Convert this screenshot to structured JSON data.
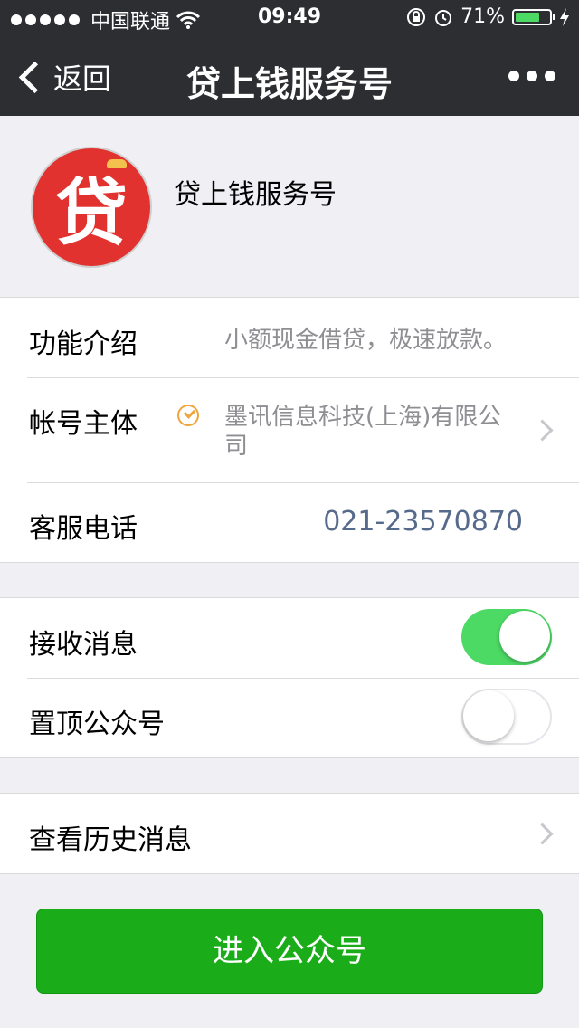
{
  "status_bar": {
    "carrier": "中国联通",
    "time": "09:49",
    "battery": "71%",
    "battery_level": 71
  },
  "nav": {
    "back_label": "返回",
    "title": "贷上钱服务号"
  },
  "profile": {
    "avatar_char": "贷",
    "name": "贷上钱服务号"
  },
  "info": {
    "intro_label": "功能介绍",
    "intro_value": "小额现金借贷，极速放款。",
    "owner_label": "帐号主体",
    "owner_value": "墨讯信息科技(上海)有限公司",
    "phone_label": "客服电话",
    "phone_value": "021-23570870"
  },
  "settings": {
    "receive_label": "接收消息",
    "receive_on": true,
    "pin_label": "置顶公众号",
    "pin_on": false
  },
  "history_label": "查看历史消息",
  "enter_button": "进入公众号",
  "colors": {
    "nav_bg": "#2d2e32",
    "green": "#1aad19",
    "toggle_on": "#4cd964",
    "phone": "#566a8b"
  }
}
